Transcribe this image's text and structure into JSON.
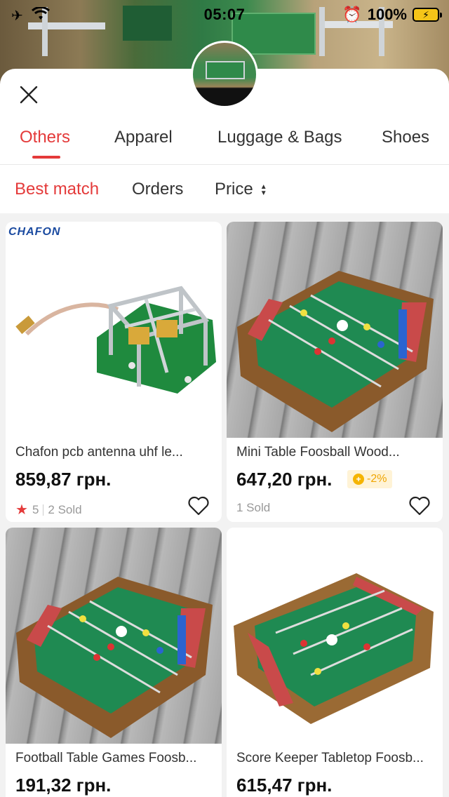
{
  "status_bar": {
    "time": "05:07",
    "battery": "100%"
  },
  "header": {
    "close_label": "✕"
  },
  "category_tabs": [
    {
      "label": "Others",
      "active": true
    },
    {
      "label": "Apparel",
      "active": false
    },
    {
      "label": "Luggage & Bags",
      "active": false
    },
    {
      "label": "Shoes",
      "active": false
    }
  ],
  "sort": {
    "best_match": "Best match",
    "orders": "Orders",
    "price": "Price"
  },
  "products": [
    {
      "brand_logo": "CHAFON",
      "title": "Chafon pcb antenna uhf le...",
      "price": "859,87 грн.",
      "rating": "5",
      "sold": "2 Sold",
      "badge": ""
    },
    {
      "title": "Mini Table Foosball Wood...",
      "price": "647,20 грн.",
      "badge": "-2%",
      "sold": "1 Sold"
    },
    {
      "title": "Football Table Games Foosb...",
      "price": "191,32 грн."
    },
    {
      "title": "Score Keeper Tabletop Foosb...",
      "price": "615,47 грн."
    }
  ],
  "colors": {
    "accent": "#e43a3a",
    "badge_bg": "#fff3d6",
    "badge_text": "#f0a500"
  }
}
